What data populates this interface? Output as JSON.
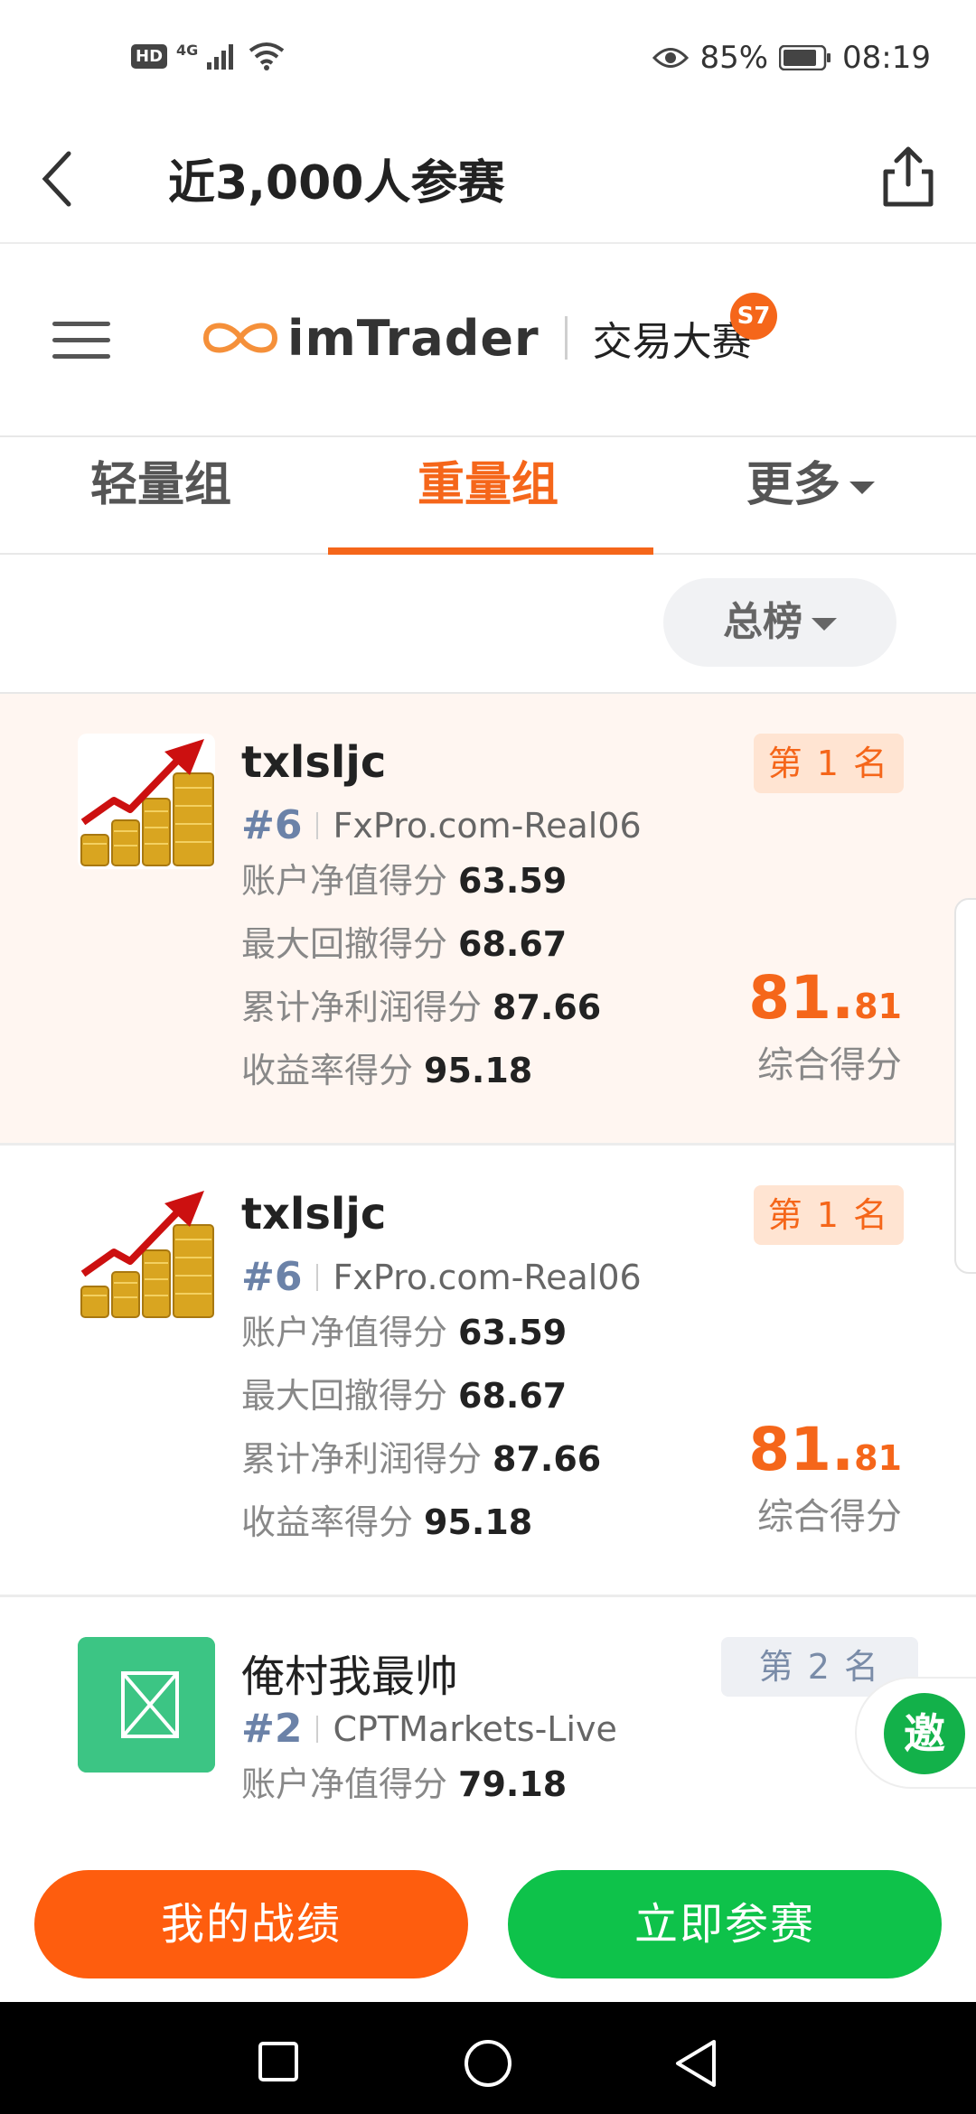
{
  "status_bar": {
    "network": "4G",
    "battery_percent": "85%",
    "time": "08:19"
  },
  "header": {
    "title": "近3,000人参赛"
  },
  "brand": {
    "logo_text": "imTrader",
    "subtitle": "交易大赛",
    "season_badge": "S7"
  },
  "tabs": [
    {
      "label": "轻量组",
      "active": false
    },
    {
      "label": "重量组",
      "active": true
    },
    {
      "label": "更多",
      "active": false
    }
  ],
  "filter": {
    "label": "总榜"
  },
  "entries": [
    {
      "username": "txlsljc",
      "id": "#6",
      "server": "FxPro.com-Real06",
      "rank": "第 1 名",
      "metrics": [
        {
          "label": "账户净值得分",
          "value": "63.59"
        },
        {
          "label": "最大回撤得分",
          "value": "68.67"
        },
        {
          "label": "累计净利润得分",
          "value": "87.66"
        },
        {
          "label": "收益率得分",
          "value": "95.18"
        }
      ],
      "score_int": "81.",
      "score_dec": "81",
      "score_label": "综合得分"
    },
    {
      "username": "txlsljc",
      "id": "#6",
      "server": "FxPro.com-Real06",
      "rank": "第 1 名",
      "metrics": [
        {
          "label": "账户净值得分",
          "value": "63.59"
        },
        {
          "label": "最大回撤得分",
          "value": "68.67"
        },
        {
          "label": "累计净利润得分",
          "value": "87.66"
        },
        {
          "label": "收益率得分",
          "value": "95.18"
        }
      ],
      "score_int": "81.",
      "score_dec": "81",
      "score_label": "综合得分"
    },
    {
      "username": "俺村我最帅",
      "id": "#2",
      "server": "CPTMarkets-Live",
      "rank": "第 2 名",
      "metrics": [
        {
          "label": "账户净值得分",
          "value": "79.18"
        }
      ]
    }
  ],
  "invite_label": "邀",
  "actions": {
    "my_record": "我的战绩",
    "join_now": "立即参赛"
  },
  "colors": {
    "accent": "#f5661a",
    "green": "#0ec24a",
    "highlight_bg": "#fff6f1"
  }
}
